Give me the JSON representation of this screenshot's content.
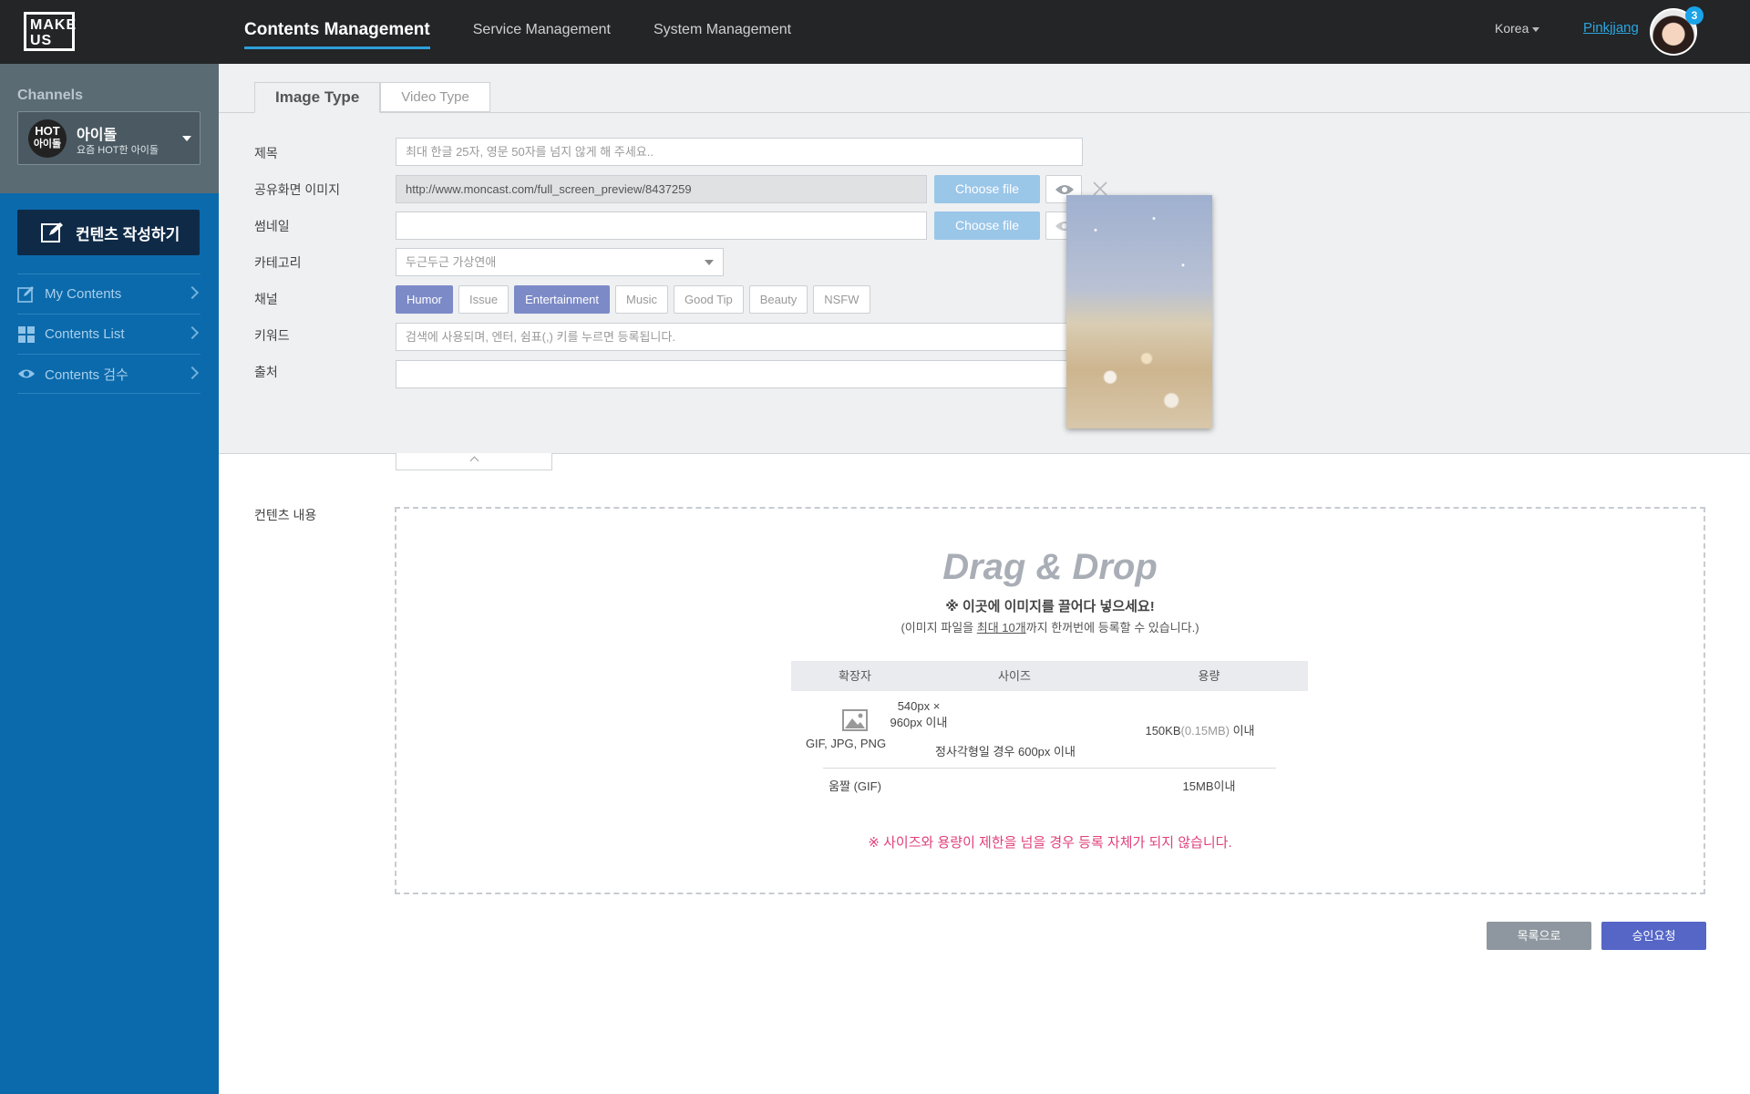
{
  "app": {
    "logo_line1": "MAKE",
    "logo_line2": "US",
    "nav": [
      "Contents Management",
      "Service Management",
      "System Management"
    ],
    "region": "Korea",
    "username": "Pinkjjang",
    "notification_count": "3"
  },
  "sidebar": {
    "channels_label": "Channels",
    "channel": {
      "badge_line1": "HOT",
      "badge_line2": "아이돌",
      "name": "아이돌",
      "subtitle": "요즘 HOT한 아이돌"
    },
    "write_button": "컨텐츠 작성하기",
    "menu": [
      {
        "label": "My Contents",
        "icon": "edit-icon"
      },
      {
        "label": "Contents List",
        "icon": "grid-icon"
      },
      {
        "label": "Contents 검수",
        "icon": "eye-icon"
      }
    ]
  },
  "form": {
    "tabs": [
      "Image Type",
      "Video Type"
    ],
    "title_label": "제목",
    "title_placeholder": "최대 한글 25자, 영문 50자를 넘지 않게 해 주세요..",
    "share_image_label": "공유화면 이미지",
    "share_image_value": "http://www.moncast.com/full_screen_preview/8437259",
    "thumbnail_label": "썸네일",
    "thumbnail_value": "",
    "choose_file": "Choose file",
    "category_label": "카테고리",
    "category_value": "두근두근 가상연애",
    "channel_label": "채널",
    "channels": [
      {
        "label": "Humor",
        "selected": true
      },
      {
        "label": "Issue",
        "selected": false
      },
      {
        "label": "Entertainment",
        "selected": true
      },
      {
        "label": "Music",
        "selected": false
      },
      {
        "label": "Good Tip",
        "selected": false
      },
      {
        "label": "Beauty",
        "selected": false
      },
      {
        "label": "NSFW",
        "selected": false
      }
    ],
    "keyword_label": "키워드",
    "keyword_placeholder": "검색에 사용되며, 엔터, 쉼표(,) 키를 누르면 등록됩니다.",
    "source_label": "출처",
    "source_value": ""
  },
  "content": {
    "label": "컨텐츠 내용",
    "dd_title": "Drag & Drop",
    "dd_sub1": "※ 이곳에 이미지를 끌어다 넣으세요!",
    "dd_sub2_pre": "(이미지 파일을 ",
    "dd_sub2_em": "최대 10개",
    "dd_sub2_post": "까지 한꺼번에 등록할 수 있습니다.)",
    "table_headers": [
      "확장자",
      "사이즈",
      "용량"
    ],
    "row1_ext": "GIF, JPG, PNG",
    "row1_size1": "540px × 960px 이내",
    "row1_size2": "정사각형일 경우 600px 이내",
    "row1_cap_main": "150KB",
    "row1_cap_muted": "(0.15MB)",
    "row1_cap_tail": " 이내",
    "row2_ext": "움짤 (GIF)",
    "row2_cap": "15MB이내",
    "warning": "※ 사이즈와 용량이 제한을 넘을 경우 등록 자체가 되지 않습니다."
  },
  "actions": {
    "list": "목록으로",
    "approve": "승인요청"
  }
}
